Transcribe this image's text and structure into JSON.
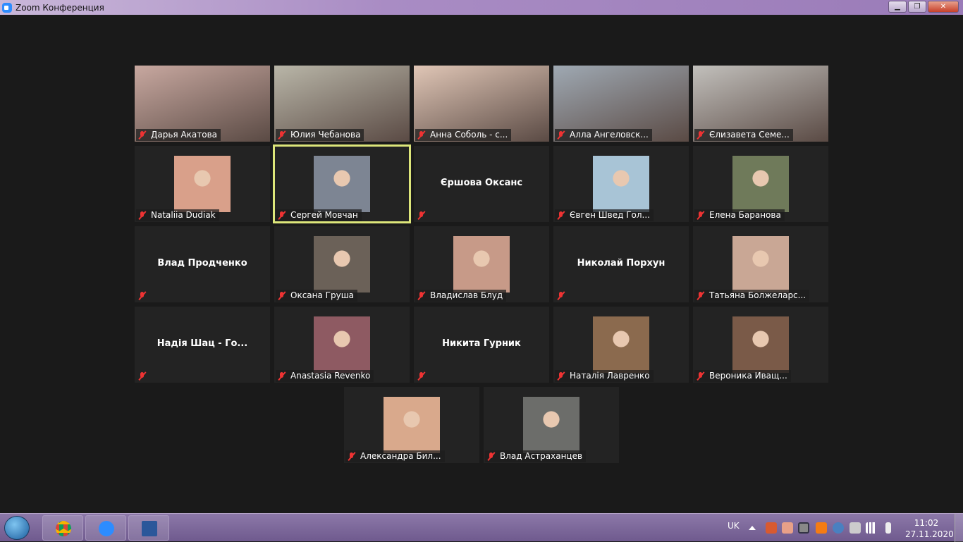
{
  "window": {
    "title": "Zoom Конференция",
    "minimize": "▁",
    "maximize": "❐",
    "close": "✕"
  },
  "participants": [
    {
      "name": "Дарья Акатова",
      "type": "video",
      "color": "#c8a8a0"
    },
    {
      "name": "Юлия Чебанова",
      "type": "video",
      "color": "#b9b6a8"
    },
    {
      "name": "Анна Соболь - с...",
      "type": "video",
      "color": "#e0c6b6"
    },
    {
      "name": "Алла Ангеловск...",
      "type": "video",
      "color": "#9fa9b3"
    },
    {
      "name": "Єлизавета Семе...",
      "type": "video",
      "color": "#c2c0bc"
    },
    {
      "name": "Nataliia Dudiak",
      "type": "avatar",
      "color": "#d9a08a"
    },
    {
      "name": "Сергей Мовчан",
      "type": "avatar",
      "color": "#7d8593",
      "active": true
    },
    {
      "name": "Єршова Оксанс",
      "type": "name"
    },
    {
      "name": "Євген Швед Гол...",
      "type": "avatar",
      "color": "#a8c4d6"
    },
    {
      "name": "Елена Баранова",
      "type": "avatar",
      "color": "#6f7a5a"
    },
    {
      "name": "Влад Продченко",
      "type": "name"
    },
    {
      "name": "Оксана Груша",
      "type": "avatar",
      "color": "#6b6158"
    },
    {
      "name": "Владислав Блуд",
      "type": "avatar",
      "color": "#c79a88"
    },
    {
      "name": "Николай Порхун",
      "type": "name"
    },
    {
      "name": "Татьяна Болжеларс...",
      "type": "avatar",
      "color": "#c9a795"
    },
    {
      "name": "Надія Шац - Го...",
      "type": "name"
    },
    {
      "name": "Anastasia Revenko",
      "type": "avatar",
      "color": "#8e5a62"
    },
    {
      "name": "Никита Гурник",
      "type": "name"
    },
    {
      "name": "Наталія Лавренко",
      "type": "avatar",
      "color": "#8b6a4e"
    },
    {
      "name": "Вероника Иващ...",
      "type": "avatar",
      "color": "#7a5a48"
    },
    {
      "name": "Александра Бил...",
      "type": "avatar",
      "color": "#d9a98c"
    },
    {
      "name": "Влад Астраханцев",
      "type": "avatar",
      "color": "#6c6d6a"
    }
  ],
  "taskbar": {
    "language": "UK",
    "time": "11:02",
    "date": "27.11.2020",
    "apps": [
      "chrome",
      "zoom",
      "word"
    ]
  }
}
